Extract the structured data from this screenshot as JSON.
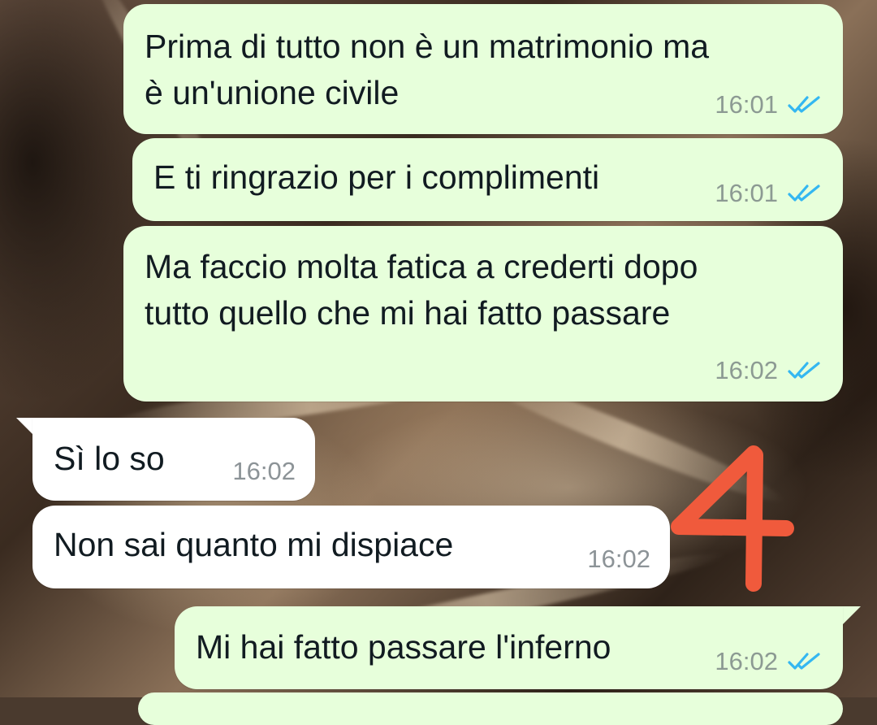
{
  "messages": [
    {
      "direction": "outgoing",
      "text": "Prima di tutto non è un matrimonio ma\nè un'unione civile",
      "time": "16:01",
      "status_icon": "double-check-read-icon"
    },
    {
      "direction": "outgoing",
      "text": "E ti ringrazio per i complimenti",
      "time": "16:01",
      "status_icon": "double-check-read-icon"
    },
    {
      "direction": "outgoing",
      "text": "Ma faccio molta fatica a crederti dopo\ntutto quello che mi hai fatto passare",
      "time": "16:02",
      "status_icon": "double-check-read-icon"
    },
    {
      "direction": "incoming",
      "text": "Sì lo so",
      "time": "16:02"
    },
    {
      "direction": "incoming",
      "text": "Non sai quanto mi dispiace",
      "time": "16:02"
    },
    {
      "direction": "outgoing",
      "text": "Mi hai fatto passare l'inferno",
      "time": "16:02",
      "status_icon": "double-check-read-icon"
    }
  ],
  "annotation": {
    "text": "4",
    "color": "#f05a3c"
  },
  "colors": {
    "outgoing_bubble": "#e7ffdb",
    "incoming_bubble": "#ffffff",
    "read_ticks": "#34b7f1"
  }
}
